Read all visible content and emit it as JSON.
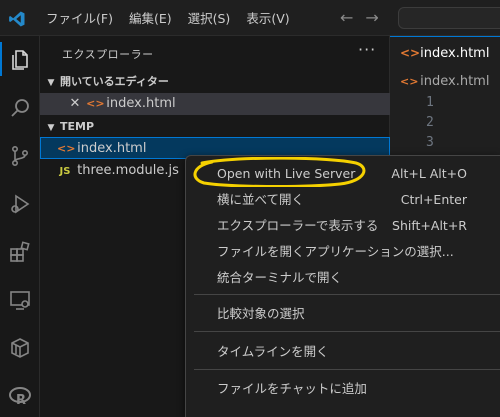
{
  "titlebar": {
    "menu": [
      "ファイル(F)",
      "編集(E)",
      "選択(S)",
      "表示(V)"
    ],
    "back_arrow": "←",
    "forward_arrow": "→"
  },
  "activity_icons": [
    "files-icon",
    "search-icon",
    "source-control-icon",
    "run-debug-icon",
    "extensions-icon",
    "remote-explorer-icon",
    "package-icon",
    "r-icon"
  ],
  "sidebar": {
    "title": "エクスプローラー",
    "more": "···",
    "open_editors": {
      "label": "開いているエディター",
      "items": [
        {
          "name": "index.html"
        }
      ]
    },
    "workspace": {
      "label": "TEMP",
      "files": [
        {
          "name": "index.html",
          "type": "html"
        },
        {
          "name": "three.module.js",
          "type": "js"
        }
      ]
    }
  },
  "editor": {
    "tab_label": "index.html",
    "breadcrumb": "index.html",
    "line_numbers": [
      "1",
      "2",
      "3"
    ]
  },
  "context_menu": {
    "items": [
      {
        "label": "Open with Live Server",
        "shortcut": "Alt+L Alt+O"
      },
      {
        "label": "横に並べて開く",
        "shortcut": "Ctrl+Enter"
      },
      {
        "label": "エクスプローラーで表示する",
        "shortcut": "Shift+Alt+R"
      },
      {
        "label": "ファイルを開くアプリケーションの選択...",
        "shortcut": ""
      },
      {
        "label": "統合ターミナルで開く",
        "shortcut": ""
      },
      {
        "label": "比較対象の選択",
        "shortcut": ""
      },
      {
        "label": "タイムラインを開く",
        "shortcut": ""
      },
      {
        "label": "ファイルをチャットに追加",
        "shortcut": ""
      }
    ]
  },
  "colors": {
    "accent": "#0078d4",
    "annotation": "#f5d100",
    "html_icon": "#e37933",
    "js_icon": "#cbcb41"
  }
}
